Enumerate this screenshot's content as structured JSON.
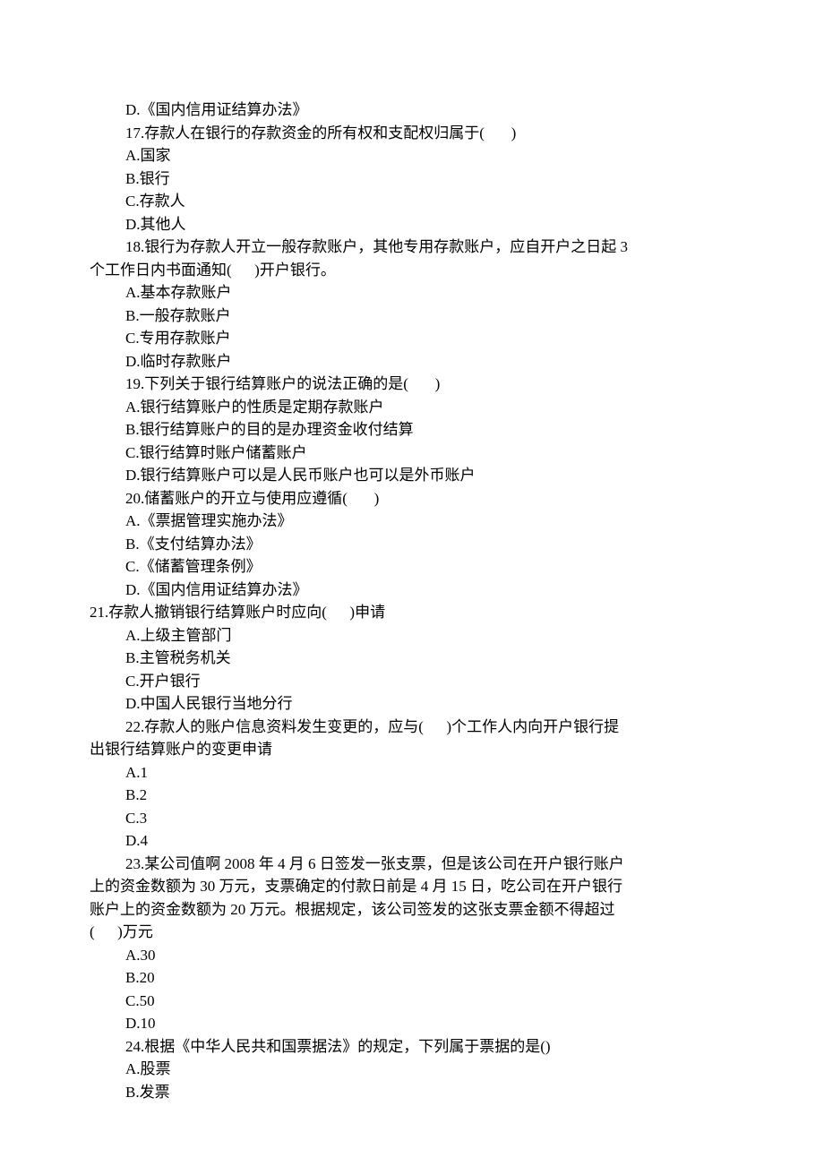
{
  "lines": [
    {
      "text": "D.《国内信用证结算办法》",
      "indent": 1
    },
    {
      "text": "17.存款人在银行的存款资金的所有权和支配权归属于(       )",
      "indent": 1
    },
    {
      "text": "A.国家",
      "indent": 1
    },
    {
      "text": "B.银行",
      "indent": 1
    },
    {
      "text": "C.存款人",
      "indent": 1
    },
    {
      "text": "D.其他人",
      "indent": 1
    },
    {
      "text": "18.银行为存款人开立一般存款账户，其他专用存款账户，应自开户之日起 3",
      "indent": 1
    },
    {
      "text": "个工作日内书面通知(      )开户银行。",
      "indent": 0
    },
    {
      "text": "A.基本存款账户",
      "indent": 1
    },
    {
      "text": "B.一般存款账户",
      "indent": 1
    },
    {
      "text": "C.专用存款账户",
      "indent": 1
    },
    {
      "text": "D.临时存款账户",
      "indent": 1
    },
    {
      "text": "19.下列关于银行结算账户的说法正确的是(       )",
      "indent": 1
    },
    {
      "text": "A.银行结算账户的性质是定期存款账户",
      "indent": 1
    },
    {
      "text": "B.银行结算账户的目的是办理资金收付结算",
      "indent": 1
    },
    {
      "text": "C.银行结算时账户储蓄账户",
      "indent": 1
    },
    {
      "text": "D.银行结算账户可以是人民币账户也可以是外币账户",
      "indent": 1
    },
    {
      "text": "20.储蓄账户的开立与使用应遵循(       )",
      "indent": 1
    },
    {
      "text": "A.《票据管理实施办法》",
      "indent": 1
    },
    {
      "text": "B.《支付结算办法》",
      "indent": 1
    },
    {
      "text": "C.《储蓄管理条例》",
      "indent": 1
    },
    {
      "text": "D.《国内信用证结算办法》",
      "indent": 1
    },
    {
      "text": "21.存款人撤销银行结算账户时应向(      )申请",
      "indent": 0
    },
    {
      "text": "A.上级主管部门",
      "indent": 1
    },
    {
      "text": "B.主管税务机关",
      "indent": 1
    },
    {
      "text": "C.开户银行",
      "indent": 1
    },
    {
      "text": "D.中国人民银行当地分行",
      "indent": 1
    },
    {
      "text": "22.存款人的账户信息资料发生变更的，应与(      )个工作人内向开户银行提",
      "indent": 1
    },
    {
      "text": "出银行结算账户的变更申请",
      "indent": 0
    },
    {
      "text": "A.1",
      "indent": 1
    },
    {
      "text": "B.2",
      "indent": 1
    },
    {
      "text": "C.3",
      "indent": 1
    },
    {
      "text": "D.4",
      "indent": 1
    },
    {
      "text": "23.某公司值啊 2008 年 4 月 6 日签发一张支票，但是该公司在开户银行账户",
      "indent": 1
    },
    {
      "text": "上的资金数额为 30 万元，支票确定的付款日前是 4 月 15 日，吃公司在开户银行",
      "indent": 0
    },
    {
      "text": "账户上的资金数额为 20 万元。根据规定，该公司签发的这张支票金额不得超过",
      "indent": 0
    },
    {
      "text": "(      )万元",
      "indent": 0
    },
    {
      "text": "A.30",
      "indent": 1
    },
    {
      "text": "B.20",
      "indent": 1
    },
    {
      "text": "C.50",
      "indent": 1
    },
    {
      "text": "D.10",
      "indent": 1
    },
    {
      "text": "24.根据《中华人民共和国票据法》的规定，下列属于票据的是()",
      "indent": 1
    },
    {
      "text": "A.股票",
      "indent": 1
    },
    {
      "text": "B.发票",
      "indent": 1
    }
  ]
}
